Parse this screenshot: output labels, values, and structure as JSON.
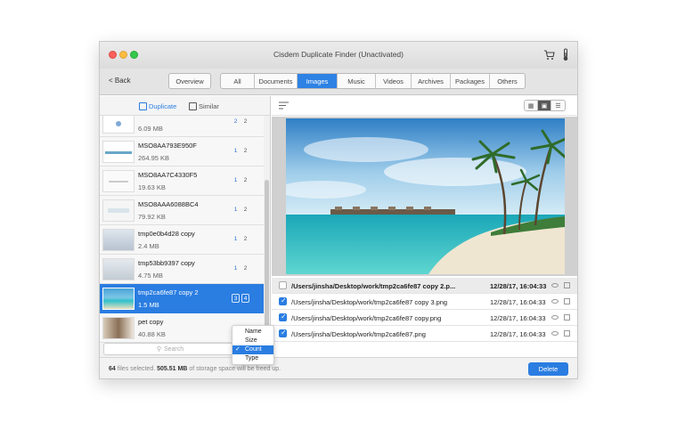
{
  "window": {
    "title": "Cisdem Duplicate Finder (Unactivated)"
  },
  "toolbar": {
    "back_label": "< Back",
    "overview_label": "Overview",
    "tabs": [
      "All",
      "Documents",
      "Images",
      "Music",
      "Videos",
      "Archives",
      "Packages",
      "Others"
    ],
    "active_tab": "Images"
  },
  "left": {
    "tabs": {
      "duplicate": "Duplicate",
      "similar": "Similar"
    },
    "items": [
      {
        "name": "",
        "size": "6.09 MB",
        "a": "2",
        "b": "2"
      },
      {
        "name": "MSO8AA793E950F",
        "size": "264.95 KB",
        "a": "1",
        "b": "2"
      },
      {
        "name": "MSO8AA7C4330F5",
        "size": "19.63 KB",
        "a": "1",
        "b": "2"
      },
      {
        "name": "MSO8AAA6088BC4",
        "size": "79.92 KB",
        "a": "1",
        "b": "2"
      },
      {
        "name": "tmp0e0b4d28 copy",
        "size": "2.4 MB",
        "a": "1",
        "b": "2"
      },
      {
        "name": "tmp53bb9397 copy",
        "size": "4.75 MB",
        "a": "1",
        "b": "2"
      },
      {
        "name": "tmp2ca6fe87 copy 2",
        "size": "1.5 MB",
        "a": "3",
        "b": "4"
      },
      {
        "name": "pet copy",
        "size": "40.88 KB",
        "a": "",
        "b": ""
      }
    ],
    "search_placeholder": "Search",
    "sort_menu": {
      "options": [
        "Name",
        "Size",
        "Count",
        "Type"
      ],
      "selected": "Count"
    }
  },
  "right": {
    "files": [
      {
        "path": "/Users/jinsha/Desktop/work/tmp2ca6fe87 copy 2.p...",
        "date": "12/28/17, 16:04:33",
        "checked": false
      },
      {
        "path": "/Users/jinsha/Desktop/work/tmp2ca6fe87 copy 3.png",
        "date": "12/28/17, 16:04:33",
        "checked": true
      },
      {
        "path": "/Users/jinsha/Desktop/work/tmp2ca6fe87 copy.png",
        "date": "12/28/17, 16:04:33",
        "checked": true
      },
      {
        "path": "/Users/jinsha/Desktop/work/tmp2ca6fe87.png",
        "date": "12/28/17, 16:04:33",
        "checked": true
      }
    ]
  },
  "status": {
    "count": "64",
    "pre": "files selected.",
    "size": "505.51 MB",
    "post": "of storage space will be freed up."
  },
  "delete_label": "Delete",
  "colors": {
    "accent": "#2a7de1",
    "traffic_close": "#fc605b",
    "traffic_min": "#fdbc40",
    "traffic_max": "#34c84a"
  }
}
